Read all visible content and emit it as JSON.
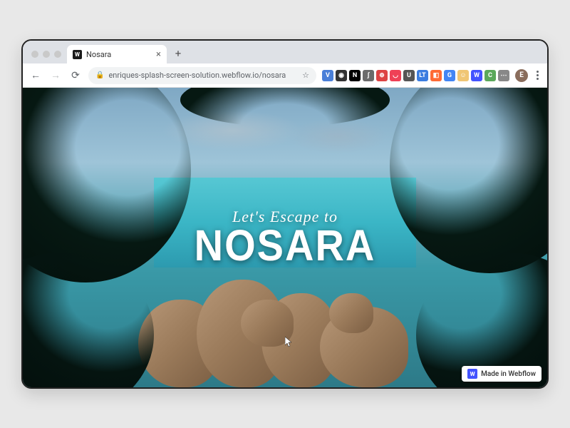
{
  "tab": {
    "title": "Nosara",
    "favicon_letter": "W"
  },
  "address": {
    "url": "enriques-splash-screen-solution.webflow.io/nosara"
  },
  "extensions": [
    {
      "bg": "#4a7fd8",
      "char": "V"
    },
    {
      "bg": "#333333",
      "char": "◉"
    },
    {
      "bg": "#000000",
      "char": "N"
    },
    {
      "bg": "#6b6b6b",
      "char": "∫"
    },
    {
      "bg": "#d44",
      "char": "⊕"
    },
    {
      "bg": "#ef4056",
      "char": "◡"
    },
    {
      "bg": "#555",
      "char": "U"
    },
    {
      "bg": "#3b7de0",
      "char": "LT"
    },
    {
      "bg": "#ff6b35",
      "char": "◧"
    },
    {
      "bg": "#4285f4",
      "char": "G"
    },
    {
      "bg": "#f0c674",
      "char": "☺"
    },
    {
      "bg": "#4353ff",
      "char": "W"
    },
    {
      "bg": "#5ba85b",
      "char": "C"
    },
    {
      "bg": "#888",
      "char": "⋯"
    }
  ],
  "profile_initial": "E",
  "hero": {
    "tagline": "Let's Escape to",
    "title": "NOSARA"
  },
  "badge": {
    "icon_letter": "W",
    "text": "Made in Webflow"
  }
}
